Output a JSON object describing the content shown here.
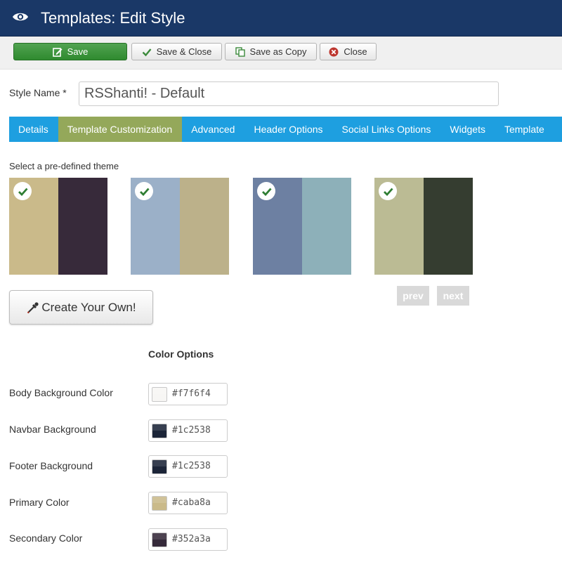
{
  "header": {
    "title": "Templates: Edit Style",
    "icon": "eye-icon"
  },
  "toolbar": {
    "save_label": "Save",
    "save_close_label": "Save & Close",
    "save_copy_label": "Save as Copy",
    "close_label": "Close"
  },
  "style_name": {
    "label": "Style Name *",
    "value": "RSShanti! - Default"
  },
  "tabs": [
    {
      "label": "Details",
      "active": false
    },
    {
      "label": "Template Customization",
      "active": true
    },
    {
      "label": "Advanced",
      "active": false
    },
    {
      "label": "Header Options",
      "active": false
    },
    {
      "label": "Social Links Options",
      "active": false
    },
    {
      "label": "Widgets",
      "active": false
    },
    {
      "label": "Template",
      "active": false
    }
  ],
  "themes": {
    "label": "Select a pre-defined theme",
    "items": [
      {
        "colors": [
          "#caba8a",
          "#372a3a"
        ],
        "checked": true
      },
      {
        "colors": [
          "#9bb0c8",
          "#bcb18a"
        ],
        "checked": true
      },
      {
        "colors": [
          "#6d80a2",
          "#8db0b9"
        ],
        "checked": true
      },
      {
        "colors": [
          "#bbbb94",
          "#353d30"
        ],
        "checked": true
      }
    ],
    "prev_label": "prev",
    "next_label": "next"
  },
  "create_own_label": "Create Your Own!",
  "color_options": {
    "title": "Color Options",
    "items": [
      {
        "label": "Body Background Color",
        "value": "#f7f6f4"
      },
      {
        "label": "Navbar Background",
        "value": "#1c2538"
      },
      {
        "label": "Footer Background",
        "value": "#1c2538"
      },
      {
        "label": "Primary Color",
        "value": "#caba8a"
      },
      {
        "label": "Secondary Color",
        "value": "#352a3a"
      }
    ]
  },
  "colors": {
    "header_bg": "#1a3867",
    "tab_bar": "#1e9fe0",
    "tab_active": "#94a85a",
    "save_button": "#3d943d",
    "checkmark": "#2e7d32"
  }
}
